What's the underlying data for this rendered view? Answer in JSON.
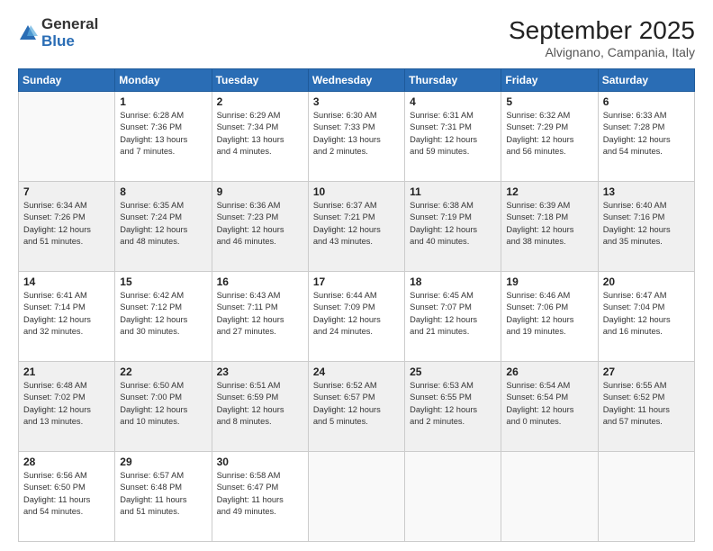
{
  "logo": {
    "general": "General",
    "blue": "Blue"
  },
  "title": {
    "month": "September 2025",
    "location": "Alvignano, Campania, Italy"
  },
  "weekdays": [
    "Sunday",
    "Monday",
    "Tuesday",
    "Wednesday",
    "Thursday",
    "Friday",
    "Saturday"
  ],
  "weeks": [
    [
      {
        "day": "",
        "info": ""
      },
      {
        "day": "1",
        "info": "Sunrise: 6:28 AM\nSunset: 7:36 PM\nDaylight: 13 hours\nand 7 minutes."
      },
      {
        "day": "2",
        "info": "Sunrise: 6:29 AM\nSunset: 7:34 PM\nDaylight: 13 hours\nand 4 minutes."
      },
      {
        "day": "3",
        "info": "Sunrise: 6:30 AM\nSunset: 7:33 PM\nDaylight: 13 hours\nand 2 minutes."
      },
      {
        "day": "4",
        "info": "Sunrise: 6:31 AM\nSunset: 7:31 PM\nDaylight: 12 hours\nand 59 minutes."
      },
      {
        "day": "5",
        "info": "Sunrise: 6:32 AM\nSunset: 7:29 PM\nDaylight: 12 hours\nand 56 minutes."
      },
      {
        "day": "6",
        "info": "Sunrise: 6:33 AM\nSunset: 7:28 PM\nDaylight: 12 hours\nand 54 minutes."
      }
    ],
    [
      {
        "day": "7",
        "info": "Sunrise: 6:34 AM\nSunset: 7:26 PM\nDaylight: 12 hours\nand 51 minutes."
      },
      {
        "day": "8",
        "info": "Sunrise: 6:35 AM\nSunset: 7:24 PM\nDaylight: 12 hours\nand 48 minutes."
      },
      {
        "day": "9",
        "info": "Sunrise: 6:36 AM\nSunset: 7:23 PM\nDaylight: 12 hours\nand 46 minutes."
      },
      {
        "day": "10",
        "info": "Sunrise: 6:37 AM\nSunset: 7:21 PM\nDaylight: 12 hours\nand 43 minutes."
      },
      {
        "day": "11",
        "info": "Sunrise: 6:38 AM\nSunset: 7:19 PM\nDaylight: 12 hours\nand 40 minutes."
      },
      {
        "day": "12",
        "info": "Sunrise: 6:39 AM\nSunset: 7:18 PM\nDaylight: 12 hours\nand 38 minutes."
      },
      {
        "day": "13",
        "info": "Sunrise: 6:40 AM\nSunset: 7:16 PM\nDaylight: 12 hours\nand 35 minutes."
      }
    ],
    [
      {
        "day": "14",
        "info": "Sunrise: 6:41 AM\nSunset: 7:14 PM\nDaylight: 12 hours\nand 32 minutes."
      },
      {
        "day": "15",
        "info": "Sunrise: 6:42 AM\nSunset: 7:12 PM\nDaylight: 12 hours\nand 30 minutes."
      },
      {
        "day": "16",
        "info": "Sunrise: 6:43 AM\nSunset: 7:11 PM\nDaylight: 12 hours\nand 27 minutes."
      },
      {
        "day": "17",
        "info": "Sunrise: 6:44 AM\nSunset: 7:09 PM\nDaylight: 12 hours\nand 24 minutes."
      },
      {
        "day": "18",
        "info": "Sunrise: 6:45 AM\nSunset: 7:07 PM\nDaylight: 12 hours\nand 21 minutes."
      },
      {
        "day": "19",
        "info": "Sunrise: 6:46 AM\nSunset: 7:06 PM\nDaylight: 12 hours\nand 19 minutes."
      },
      {
        "day": "20",
        "info": "Sunrise: 6:47 AM\nSunset: 7:04 PM\nDaylight: 12 hours\nand 16 minutes."
      }
    ],
    [
      {
        "day": "21",
        "info": "Sunrise: 6:48 AM\nSunset: 7:02 PM\nDaylight: 12 hours\nand 13 minutes."
      },
      {
        "day": "22",
        "info": "Sunrise: 6:50 AM\nSunset: 7:00 PM\nDaylight: 12 hours\nand 10 minutes."
      },
      {
        "day": "23",
        "info": "Sunrise: 6:51 AM\nSunset: 6:59 PM\nDaylight: 12 hours\nand 8 minutes."
      },
      {
        "day": "24",
        "info": "Sunrise: 6:52 AM\nSunset: 6:57 PM\nDaylight: 12 hours\nand 5 minutes."
      },
      {
        "day": "25",
        "info": "Sunrise: 6:53 AM\nSunset: 6:55 PM\nDaylight: 12 hours\nand 2 minutes."
      },
      {
        "day": "26",
        "info": "Sunrise: 6:54 AM\nSunset: 6:54 PM\nDaylight: 12 hours\nand 0 minutes."
      },
      {
        "day": "27",
        "info": "Sunrise: 6:55 AM\nSunset: 6:52 PM\nDaylight: 11 hours\nand 57 minutes."
      }
    ],
    [
      {
        "day": "28",
        "info": "Sunrise: 6:56 AM\nSunset: 6:50 PM\nDaylight: 11 hours\nand 54 minutes."
      },
      {
        "day": "29",
        "info": "Sunrise: 6:57 AM\nSunset: 6:48 PM\nDaylight: 11 hours\nand 51 minutes."
      },
      {
        "day": "30",
        "info": "Sunrise: 6:58 AM\nSunset: 6:47 PM\nDaylight: 11 hours\nand 49 minutes."
      },
      {
        "day": "",
        "info": ""
      },
      {
        "day": "",
        "info": ""
      },
      {
        "day": "",
        "info": ""
      },
      {
        "day": "",
        "info": ""
      }
    ]
  ]
}
